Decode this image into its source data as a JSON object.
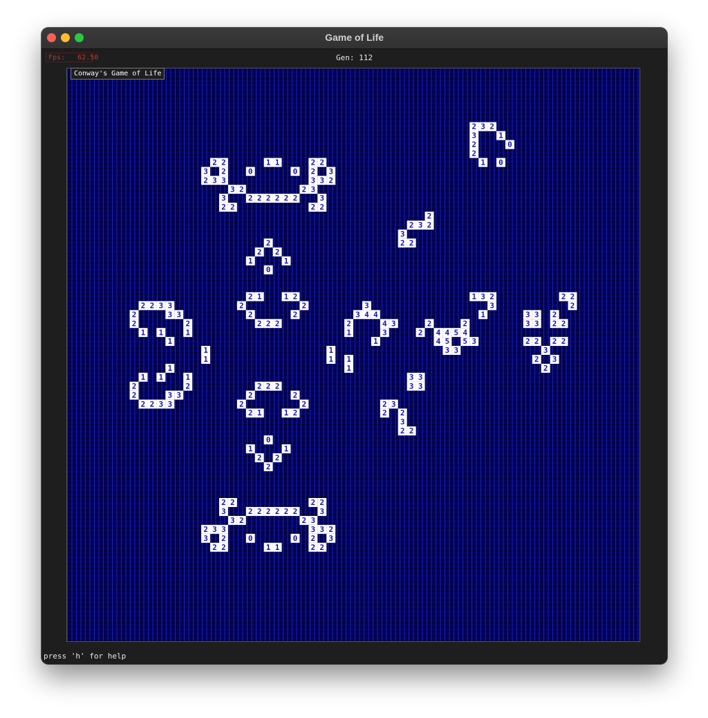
{
  "window": {
    "title": "Game of Life"
  },
  "hud": {
    "fps_label": "Fps:",
    "fps_value": "62.50",
    "generation": "Gen: 112"
  },
  "board": {
    "title": "Conway's Game of Life",
    "grid_size": 64,
    "alive_color": "#ffffff",
    "neighbor_color": "#1010c0",
    "empty_color": "#03035e",
    "cells": [
      [
        45,
        6,
        "2"
      ],
      [
        46,
        6,
        "3"
      ],
      [
        47,
        6,
        "2"
      ],
      [
        45,
        7,
        "3"
      ],
      [
        48,
        7,
        "1"
      ],
      [
        45,
        8,
        "2"
      ],
      [
        49,
        8,
        "0"
      ],
      [
        45,
        9,
        "2"
      ],
      [
        46,
        10,
        "1"
      ],
      [
        48,
        10,
        "0"
      ],
      [
        16,
        10,
        "2"
      ],
      [
        17,
        10,
        "2"
      ],
      [
        22,
        10,
        "1"
      ],
      [
        23,
        10,
        "1"
      ],
      [
        27,
        10,
        "2"
      ],
      [
        28,
        10,
        "2"
      ],
      [
        15,
        11,
        "3"
      ],
      [
        17,
        11,
        "2"
      ],
      [
        20,
        11,
        "0"
      ],
      [
        25,
        11,
        "0"
      ],
      [
        27,
        11,
        "2"
      ],
      [
        29,
        11,
        "3"
      ],
      [
        15,
        12,
        "2"
      ],
      [
        16,
        12,
        "3"
      ],
      [
        17,
        12,
        "3"
      ],
      [
        27,
        12,
        "3"
      ],
      [
        28,
        12,
        "3"
      ],
      [
        29,
        12,
        "2"
      ],
      [
        18,
        13,
        "3"
      ],
      [
        19,
        13,
        "2"
      ],
      [
        26,
        13,
        "2"
      ],
      [
        27,
        13,
        "3"
      ],
      [
        17,
        14,
        "3"
      ],
      [
        20,
        14,
        "2"
      ],
      [
        21,
        14,
        "2"
      ],
      [
        22,
        14,
        "2"
      ],
      [
        23,
        14,
        "2"
      ],
      [
        24,
        14,
        "2"
      ],
      [
        25,
        14,
        "2"
      ],
      [
        28,
        14,
        "3"
      ],
      [
        17,
        15,
        "2"
      ],
      [
        18,
        15,
        "2"
      ],
      [
        27,
        15,
        "2"
      ],
      [
        28,
        15,
        "2"
      ],
      [
        40,
        16,
        "2"
      ],
      [
        38,
        17,
        "2"
      ],
      [
        39,
        17,
        "3"
      ],
      [
        40,
        17,
        "2"
      ],
      [
        37,
        18,
        "3"
      ],
      [
        37,
        19,
        "2"
      ],
      [
        38,
        19,
        "2"
      ],
      [
        22,
        19,
        "2"
      ],
      [
        21,
        20,
        "2"
      ],
      [
        23,
        20,
        "2"
      ],
      [
        20,
        21,
        "1"
      ],
      [
        24,
        21,
        "1"
      ],
      [
        22,
        22,
        "0"
      ],
      [
        45,
        25,
        "1"
      ],
      [
        46,
        25,
        "3"
      ],
      [
        47,
        25,
        "2"
      ],
      [
        55,
        25,
        "2"
      ],
      [
        56,
        25,
        "2"
      ],
      [
        20,
        25,
        "2"
      ],
      [
        21,
        25,
        "1"
      ],
      [
        24,
        25,
        "1"
      ],
      [
        25,
        25,
        "2"
      ],
      [
        8,
        26,
        "2"
      ],
      [
        9,
        26,
        "2"
      ],
      [
        10,
        26,
        "3"
      ],
      [
        11,
        26,
        "3"
      ],
      [
        19,
        26,
        "2"
      ],
      [
        26,
        26,
        "2"
      ],
      [
        33,
        26,
        "3"
      ],
      [
        47,
        26,
        "3"
      ],
      [
        56,
        26,
        "2"
      ],
      [
        7,
        27,
        "2"
      ],
      [
        11,
        27,
        "3"
      ],
      [
        12,
        27,
        "3"
      ],
      [
        20,
        27,
        "2"
      ],
      [
        25,
        27,
        "2"
      ],
      [
        32,
        27,
        "3"
      ],
      [
        33,
        27,
        "4"
      ],
      [
        34,
        27,
        "4"
      ],
      [
        46,
        27,
        "1"
      ],
      [
        51,
        27,
        "3"
      ],
      [
        52,
        27,
        "3"
      ],
      [
        54,
        27,
        "2"
      ],
      [
        7,
        28,
        "2"
      ],
      [
        13,
        28,
        "2"
      ],
      [
        21,
        28,
        "2"
      ],
      [
        22,
        28,
        "2"
      ],
      [
        23,
        28,
        "2"
      ],
      [
        31,
        28,
        "2"
      ],
      [
        35,
        28,
        "4"
      ],
      [
        36,
        28,
        "3"
      ],
      [
        40,
        28,
        "2"
      ],
      [
        44,
        28,
        "2"
      ],
      [
        51,
        28,
        "3"
      ],
      [
        52,
        28,
        "3"
      ],
      [
        54,
        28,
        "2"
      ],
      [
        55,
        28,
        "2"
      ],
      [
        8,
        29,
        "1"
      ],
      [
        10,
        29,
        "1"
      ],
      [
        13,
        29,
        "1"
      ],
      [
        31,
        29,
        "1"
      ],
      [
        35,
        29,
        "3"
      ],
      [
        39,
        29,
        "2"
      ],
      [
        41,
        29,
        "4"
      ],
      [
        42,
        29,
        "4"
      ],
      [
        43,
        29,
        "5"
      ],
      [
        44,
        29,
        "4"
      ],
      [
        11,
        30,
        "1"
      ],
      [
        34,
        30,
        "1"
      ],
      [
        41,
        30,
        "4"
      ],
      [
        42,
        30,
        "5"
      ],
      [
        44,
        30,
        "5"
      ],
      [
        45,
        30,
        "3"
      ],
      [
        51,
        30,
        "2"
      ],
      [
        52,
        30,
        "2"
      ],
      [
        54,
        30,
        "2"
      ],
      [
        55,
        30,
        "2"
      ],
      [
        15,
        31,
        "1"
      ],
      [
        29,
        31,
        "1"
      ],
      [
        42,
        31,
        "3"
      ],
      [
        43,
        31,
        "3"
      ],
      [
        53,
        31,
        "3"
      ],
      [
        15,
        32,
        "1"
      ],
      [
        29,
        32,
        "1"
      ],
      [
        31,
        32,
        "1"
      ],
      [
        52,
        32,
        "2"
      ],
      [
        54,
        32,
        "3"
      ],
      [
        11,
        33,
        "1"
      ],
      [
        31,
        33,
        "1"
      ],
      [
        53,
        33,
        "2"
      ],
      [
        8,
        34,
        "1"
      ],
      [
        10,
        34,
        "1"
      ],
      [
        13,
        34,
        "1"
      ],
      [
        38,
        34,
        "3"
      ],
      [
        39,
        34,
        "3"
      ],
      [
        7,
        35,
        "2"
      ],
      [
        13,
        35,
        "2"
      ],
      [
        21,
        35,
        "2"
      ],
      [
        22,
        35,
        "2"
      ],
      [
        23,
        35,
        "2"
      ],
      [
        38,
        35,
        "3"
      ],
      [
        39,
        35,
        "3"
      ],
      [
        7,
        36,
        "2"
      ],
      [
        11,
        36,
        "3"
      ],
      [
        12,
        36,
        "3"
      ],
      [
        20,
        36,
        "2"
      ],
      [
        25,
        36,
        "2"
      ],
      [
        8,
        37,
        "2"
      ],
      [
        9,
        37,
        "2"
      ],
      [
        10,
        37,
        "3"
      ],
      [
        11,
        37,
        "3"
      ],
      [
        19,
        37,
        "2"
      ],
      [
        26,
        37,
        "2"
      ],
      [
        35,
        37,
        "2"
      ],
      [
        36,
        37,
        "3"
      ],
      [
        20,
        38,
        "2"
      ],
      [
        21,
        38,
        "1"
      ],
      [
        24,
        38,
        "1"
      ],
      [
        25,
        38,
        "2"
      ],
      [
        35,
        38,
        "2"
      ],
      [
        37,
        38,
        "2"
      ],
      [
        37,
        39,
        "3"
      ],
      [
        37,
        40,
        "2"
      ],
      [
        38,
        40,
        "2"
      ],
      [
        22,
        41,
        "0"
      ],
      [
        20,
        42,
        "1"
      ],
      [
        24,
        42,
        "1"
      ],
      [
        21,
        43,
        "2"
      ],
      [
        23,
        43,
        "2"
      ],
      [
        22,
        44,
        "2"
      ],
      [
        17,
        48,
        "2"
      ],
      [
        18,
        48,
        "2"
      ],
      [
        27,
        48,
        "2"
      ],
      [
        28,
        48,
        "2"
      ],
      [
        17,
        49,
        "3"
      ],
      [
        20,
        49,
        "2"
      ],
      [
        21,
        49,
        "2"
      ],
      [
        22,
        49,
        "2"
      ],
      [
        23,
        49,
        "2"
      ],
      [
        24,
        49,
        "2"
      ],
      [
        25,
        49,
        "2"
      ],
      [
        28,
        49,
        "3"
      ],
      [
        18,
        50,
        "3"
      ],
      [
        19,
        50,
        "2"
      ],
      [
        26,
        50,
        "2"
      ],
      [
        27,
        50,
        "3"
      ],
      [
        15,
        51,
        "2"
      ],
      [
        16,
        51,
        "3"
      ],
      [
        17,
        51,
        "3"
      ],
      [
        27,
        51,
        "3"
      ],
      [
        28,
        51,
        "3"
      ],
      [
        29,
        51,
        "2"
      ],
      [
        15,
        52,
        "3"
      ],
      [
        17,
        52,
        "2"
      ],
      [
        20,
        52,
        "0"
      ],
      [
        25,
        52,
        "0"
      ],
      [
        27,
        52,
        "2"
      ],
      [
        29,
        52,
        "3"
      ],
      [
        16,
        53,
        "2"
      ],
      [
        17,
        53,
        "2"
      ],
      [
        22,
        53,
        "1"
      ],
      [
        23,
        53,
        "1"
      ],
      [
        27,
        53,
        "2"
      ],
      [
        28,
        53,
        "2"
      ]
    ]
  },
  "footer": {
    "help": "press 'h' for help"
  }
}
